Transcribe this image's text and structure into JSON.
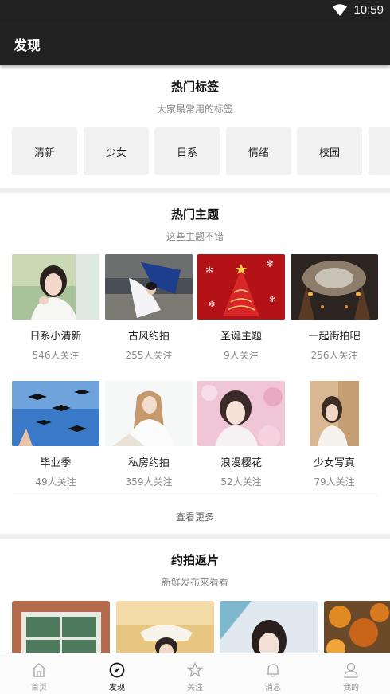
{
  "status_bar": {
    "time": "10:59"
  },
  "app_bar": {
    "title": "发现"
  },
  "hot_tags": {
    "title": "热门标签",
    "subtitle": "大家最常用的标签",
    "tags": [
      "清新",
      "少女",
      "日系",
      "情绪",
      "校园",
      ""
    ]
  },
  "hot_themes": {
    "title": "热门主题",
    "subtitle": "这些主题不错",
    "items": [
      {
        "name": "日系小清新",
        "count": "546人关注"
      },
      {
        "name": "古风约拍",
        "count": "255人关注"
      },
      {
        "name": "圣诞主题",
        "count": "9人关注"
      },
      {
        "name": "一起街拍吧",
        "count": "256人关注"
      },
      {
        "name": "毕业季",
        "count": "49人关注"
      },
      {
        "name": "私房约拍",
        "count": "359人关注"
      },
      {
        "name": "浪漫樱花",
        "count": "52人关注"
      },
      {
        "name": "少女写真",
        "count": "79人关注"
      }
    ],
    "more_label": "查看更多"
  },
  "returns": {
    "title": "约拍返片",
    "subtitle": "新鲜发布来看看"
  },
  "bottom_nav": {
    "items": [
      {
        "label": "首页",
        "icon": "home-icon"
      },
      {
        "label": "发现",
        "icon": "compass-icon"
      },
      {
        "label": "关注",
        "icon": "star-icon"
      },
      {
        "label": "消息",
        "icon": "bell-icon"
      },
      {
        "label": "我的",
        "icon": "person-icon"
      }
    ],
    "active_index": 1
  }
}
